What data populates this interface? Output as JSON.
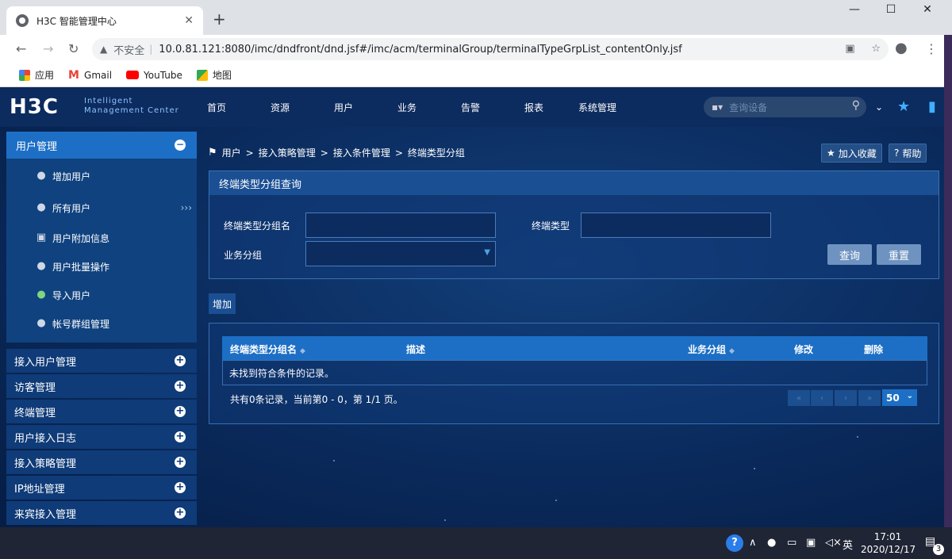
{
  "browser": {
    "tab_title": "H3C 智能管理中心",
    "url_warning": "不安全",
    "url": "10.0.81.121:8080/imc/dndfront/dnd.jsf#/imc/acm/terminalGroup/terminalTypeGrpList_contentOnly.jsf",
    "bookmarks": [
      {
        "label": "应用",
        "icon": "apps-grid-icon"
      },
      {
        "label": "Gmail",
        "icon": "gmail-icon"
      },
      {
        "label": "YouTube",
        "icon": "youtube-icon"
      },
      {
        "label": "地图",
        "icon": "maps-icon"
      }
    ]
  },
  "app": {
    "logo": "H3C",
    "logo_sub1": "Intelligent",
    "logo_sub2": "Management Center",
    "menu": [
      "首页",
      "资源",
      "用户",
      "业务",
      "告警",
      "报表",
      "系统管理"
    ],
    "search_placeholder": "查询设备"
  },
  "sidebar": {
    "active_group": "用户管理",
    "sub_items": [
      {
        "label": "增加用户",
        "icon": "add-user-icon"
      },
      {
        "label": "所有用户",
        "icon": "users-icon"
      },
      {
        "label": "用户附加信息",
        "icon": "id-card-icon"
      },
      {
        "label": "用户批量操作",
        "icon": "batch-users-icon"
      },
      {
        "label": "导入用户",
        "icon": "import-user-icon"
      },
      {
        "label": "帐号群组管理",
        "icon": "group-icon"
      }
    ],
    "chevron": "›››",
    "groups": [
      "接入用户管理",
      "访客管理",
      "终端管理",
      "用户接入日志",
      "接入策略管理",
      "IP地址管理",
      "来宾接入管理"
    ]
  },
  "breadcrumb": {
    "items": [
      "用户",
      "接入策略管理",
      "接入条件管理",
      "终端类型分组"
    ],
    "separator": ">"
  },
  "actions": {
    "favorite": "加入收藏",
    "help": "帮助"
  },
  "query": {
    "title": "终端类型分组查询",
    "group_name_label": "终端类型分组名",
    "group_name_value": "",
    "terminal_type_label": "终端类型",
    "terminal_type_value": "",
    "service_group_label": "业务分组",
    "service_group_value": "",
    "search_button": "查询",
    "reset_button": "重置"
  },
  "add_button": "增加",
  "table": {
    "columns": [
      "终端类型分组名",
      "描述",
      "业务分组",
      "修改",
      "删除"
    ],
    "empty_message": "未找到符合条件的记录。",
    "footer": "共有0条记录，当前第0 - 0，第 1/1 页。",
    "page_size": "50"
  },
  "taskbar": {
    "ime": "英",
    "time": "17:01",
    "date": "2020/12/17",
    "notifications": "3"
  }
}
